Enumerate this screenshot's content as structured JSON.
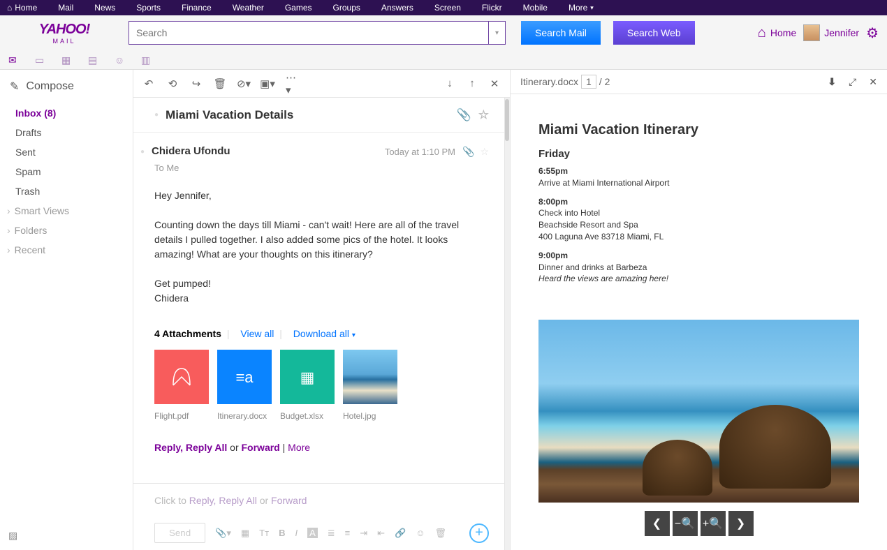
{
  "topnav": [
    "Home",
    "Mail",
    "News",
    "Sports",
    "Finance",
    "Weather",
    "Games",
    "Groups",
    "Answers",
    "Screen",
    "Flickr",
    "Mobile",
    "More"
  ],
  "logo": {
    "brand": "YAHOO!",
    "product": "MAIL"
  },
  "search": {
    "placeholder": "Search",
    "mail_btn": "Search Mail",
    "web_btn": "Search Web"
  },
  "header_links": {
    "home": "Home",
    "user": "Jennifer"
  },
  "sidebar": {
    "compose": "Compose",
    "folders": [
      "Inbox (8)",
      "Drafts",
      "Sent",
      "Spam",
      "Trash"
    ],
    "sections": [
      "Smart Views",
      "Folders",
      "Recent"
    ]
  },
  "mail": {
    "subject": "Miami Vacation Details",
    "sender": "Chidera Ufondu",
    "time": "Today at 1:10 PM",
    "to": "To Me",
    "greeting": "Hey Jennifer,",
    "body": "Counting down the days till Miami - can't wait! Here are all of the travel details I pulled together. I also added some pics of the hotel. It looks amazing! What are your thoughts on this itinerary?",
    "sig1": "Get pumped!",
    "sig2": "Chidera",
    "attach_label": "4 Attachments",
    "view_all": "View all",
    "download_all": "Download all",
    "attachments": [
      {
        "name": "Flight.pdf",
        "bg": "#f85c5c",
        "glyph": "pdf"
      },
      {
        "name": "Itinerary.docx",
        "bg": "#0a84ff",
        "glyph": "doc"
      },
      {
        "name": "Budget.xlsx",
        "bg": "#14b89a",
        "glyph": "xls"
      },
      {
        "name": "Hotel.jpg",
        "bg": "beach",
        "glyph": "img"
      }
    ],
    "reply_links": {
      "reply": "Reply,",
      "reply_all": "Reply All",
      "or": "or",
      "forward": "Forward",
      "sep": "|",
      "more": "More"
    },
    "reply_placeholder_pre": "Click to ",
    "reply_placeholder_mid": "Reply, Reply All",
    "reply_placeholder_or": " or ",
    "reply_placeholder_fwd": "Forward",
    "send": "Send"
  },
  "preview": {
    "filename": "Itinerary.docx",
    "page_current": "1",
    "page_total": "/ 2",
    "doc": {
      "title": "Miami Vacation Itinerary",
      "day": "Friday",
      "e1_time": "6:55pm",
      "e1_line": "Arrive at Miami International Airport",
      "e2_time": "8:00pm",
      "e2_l1": "Check into Hotel",
      "e2_l2": "Beachside Resort and Spa",
      "e2_l3": "400 Laguna Ave 83718 Miami, FL",
      "e3_time": "9:00pm",
      "e3_l1": "Dinner and drinks at Barbeza",
      "e3_l2": "Heard the views are amazing here!"
    }
  }
}
